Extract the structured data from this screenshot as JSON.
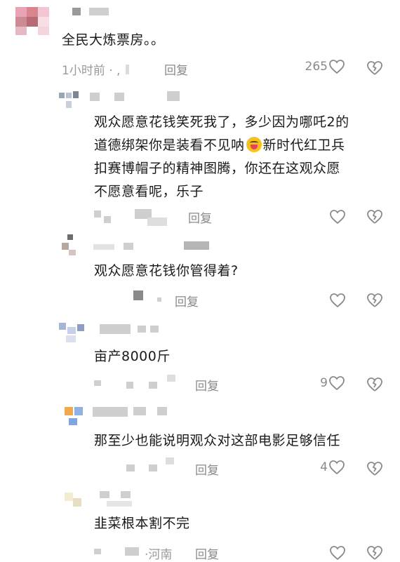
{
  "comments": [
    {
      "text": "全民大炼票房。。",
      "time": "1小时前 · ,",
      "reply_label": "回复",
      "likes": "265"
    },
    {
      "text_lines": [
        "观众愿意花钱笑死我了，多少因为哪吒2的",
        "道德绑架你是装看不见呐",
        "新时代红卫兵",
        "扣赛博帽子的精神图腾，你还在这观众愿",
        "不愿意看呢，乐子"
      ],
      "reply_label": "回复",
      "likes": ""
    },
    {
      "text": "观众愿意花钱你管得着?",
      "reply_label": "回复",
      "likes": ""
    },
    {
      "text": "亩产8000斤",
      "reply_label": "回复",
      "likes": "9"
    },
    {
      "text": "那至少也能说明观众对这部电影足够信任",
      "reply_label": "回复",
      "likes": "4"
    },
    {
      "text": "韭菜根本割不完",
      "location": "·河南",
      "reply_label": "回复",
      "likes": ""
    }
  ],
  "icons": {
    "like": "heart-outline-icon",
    "dislike": "broken-heart-icon",
    "emoji": "tongue-out-emoji-icon"
  },
  "colors": {
    "text": "#1a1a1a",
    "meta": "#9a9a9a",
    "icon_stroke": "#8a8a8a"
  }
}
